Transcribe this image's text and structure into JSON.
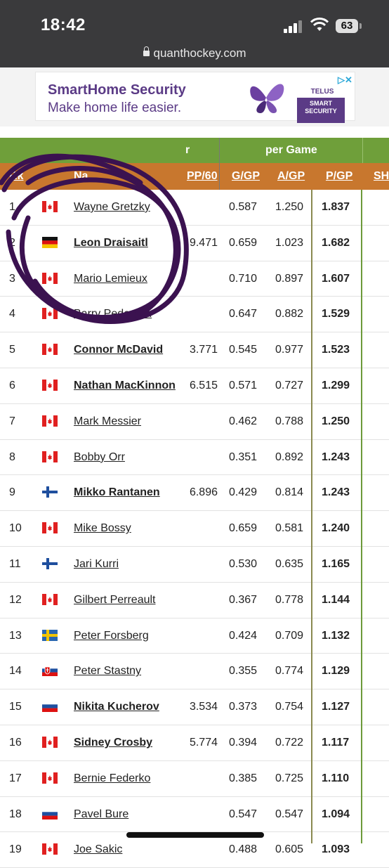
{
  "status": {
    "time": "18:42",
    "battery": "63"
  },
  "browser": {
    "url": "quanthockey.com"
  },
  "ad": {
    "headline": "SmartHome Security",
    "tagline": "Make home life easier.",
    "brand": "TELUS",
    "box_text": "SMART SECURITY",
    "close_icon": "close-icon"
  },
  "table": {
    "group_header_left": "r",
    "group_header": "per Game",
    "columns": {
      "rank": "Rk",
      "name": "Na",
      "pp60": "PP/60",
      "g": "G/GP",
      "a": "A/GP",
      "p": "P/GP",
      "sh": "SH"
    },
    "highlight_color": "#f7fa9a",
    "rows": [
      {
        "rank": "1",
        "flag": "canada",
        "name": "Wayne Gretzky",
        "active": false,
        "pp60": "",
        "g": "0.587",
        "a": "1.250",
        "p": "1.837"
      },
      {
        "rank": "2",
        "flag": "germany",
        "name": "Leon Draisaitl",
        "active": true,
        "pp60": "9.471",
        "g": "0.659",
        "a": "1.023",
        "p": "1.682"
      },
      {
        "rank": "3",
        "flag": "canada",
        "name": "Mario Lemieux",
        "active": false,
        "pp60": "",
        "g": "0.710",
        "a": "0.897",
        "p": "1.607"
      },
      {
        "rank": "4",
        "flag": "canada",
        "name": "Barry Pederson",
        "active": false,
        "pp60": "",
        "g": "0.647",
        "a": "0.882",
        "p": "1.529"
      },
      {
        "rank": "5",
        "flag": "canada",
        "name": "Connor McDavid",
        "active": true,
        "pp60": "3.771",
        "g": "0.545",
        "a": "0.977",
        "p": "1.523"
      },
      {
        "rank": "6",
        "flag": "canada",
        "name": "Nathan MacKinnon",
        "active": true,
        "pp60": "6.515",
        "g": "0.571",
        "a": "0.727",
        "p": "1.299"
      },
      {
        "rank": "7",
        "flag": "canada",
        "name": "Mark Messier",
        "active": false,
        "pp60": "",
        "g": "0.462",
        "a": "0.788",
        "p": "1.250"
      },
      {
        "rank": "8",
        "flag": "canada",
        "name": "Bobby Orr",
        "active": false,
        "pp60": "",
        "g": "0.351",
        "a": "0.892",
        "p": "1.243"
      },
      {
        "rank": "9",
        "flag": "finland",
        "name": "Mikko Rantanen",
        "active": true,
        "pp60": "6.896",
        "g": "0.429",
        "a": "0.814",
        "p": "1.243"
      },
      {
        "rank": "10",
        "flag": "canada",
        "name": "Mike Bossy",
        "active": false,
        "pp60": "",
        "g": "0.659",
        "a": "0.581",
        "p": "1.240"
      },
      {
        "rank": "11",
        "flag": "finland",
        "name": "Jari Kurri",
        "active": false,
        "pp60": "",
        "g": "0.530",
        "a": "0.635",
        "p": "1.165"
      },
      {
        "rank": "12",
        "flag": "canada",
        "name": "Gilbert Perreault",
        "active": false,
        "pp60": "",
        "g": "0.367",
        "a": "0.778",
        "p": "1.144"
      },
      {
        "rank": "13",
        "flag": "sweden",
        "name": "Peter Forsberg",
        "active": false,
        "pp60": "",
        "g": "0.424",
        "a": "0.709",
        "p": "1.132"
      },
      {
        "rank": "14",
        "flag": "slovakia",
        "name": "Peter Stastny",
        "active": false,
        "pp60": "",
        "g": "0.355",
        "a": "0.774",
        "p": "1.129"
      },
      {
        "rank": "15",
        "flag": "russia",
        "name": "Nikita Kucherov",
        "active": true,
        "pp60": "3.534",
        "g": "0.373",
        "a": "0.754",
        "p": "1.127"
      },
      {
        "rank": "16",
        "flag": "canada",
        "name": "Sidney Crosby",
        "active": true,
        "pp60": "5.774",
        "g": "0.394",
        "a": "0.722",
        "p": "1.117"
      },
      {
        "rank": "17",
        "flag": "canada",
        "name": "Bernie Federko",
        "active": false,
        "pp60": "",
        "g": "0.385",
        "a": "0.725",
        "p": "1.110"
      },
      {
        "rank": "18",
        "flag": "russia",
        "name": "Pavel Bure",
        "active": false,
        "pp60": "",
        "g": "0.547",
        "a": "0.547",
        "p": "1.094"
      },
      {
        "rank": "19",
        "flag": "canada",
        "name": "Joe Sakic",
        "active": false,
        "pp60": "",
        "g": "0.488",
        "a": "0.605",
        "p": "1.093"
      }
    ]
  }
}
